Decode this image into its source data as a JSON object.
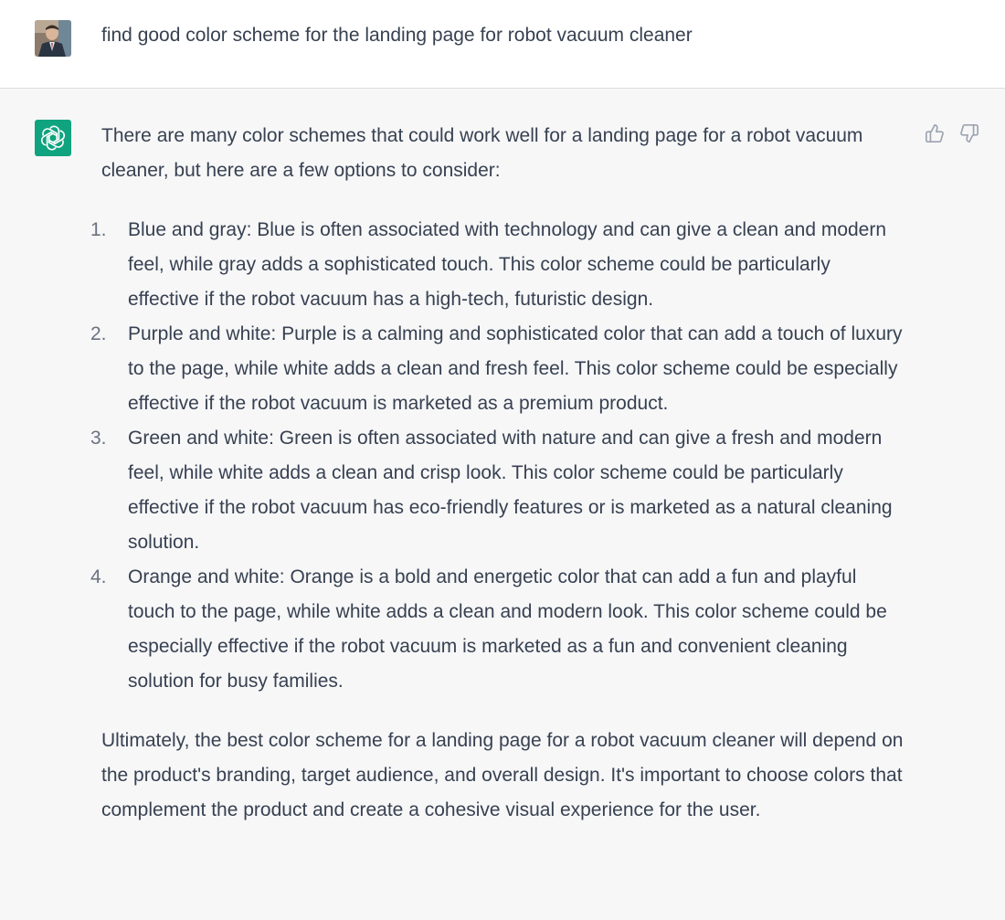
{
  "user_message": {
    "text": "find good color scheme for the landing page for robot vacuum cleaner"
  },
  "assistant_message": {
    "intro": "There are many color schemes that could work well for a landing page for a robot vacuum cleaner, but here are a few options to consider:",
    "items": [
      {
        "number": "1.",
        "text": "Blue and gray: Blue is often associated with technology and can give a clean and modern feel, while gray adds a sophisticated touch. This color scheme could be particularly effective if the robot vacuum has a high-tech, futuristic design."
      },
      {
        "number": "2.",
        "text": "Purple and white: Purple is a calming and sophisticated color that can add a touch of luxury to the page, while white adds a clean and fresh feel. This color scheme could be especially effective if the robot vacuum is marketed as a premium product."
      },
      {
        "number": "3.",
        "text": "Green and white: Green is often associated with nature and can give a fresh and modern feel, while white adds a clean and crisp look. This color scheme could be particularly effective if the robot vacuum has eco-friendly features or is marketed as a natural cleaning solution."
      },
      {
        "number": "4.",
        "text": "Orange and white: Orange is a bold and energetic color that can add a fun and playful touch to the page, while white adds a clean and modern look. This color scheme could be especially effective if the robot vacuum is marketed as a fun and convenient cleaning solution for busy families."
      }
    ],
    "conclusion": "Ultimately, the best color scheme for a landing page for a robot vacuum cleaner will depend on the product's branding, target audience, and overall design. It's important to choose colors that complement the product and create a cohesive visual experience for the user."
  },
  "icons": {
    "assistant_avatar": "openai-logo-icon",
    "thumbs_up": "thumbs-up-icon",
    "thumbs_down": "thumbs-down-icon"
  },
  "colors": {
    "assistant_avatar_bg": "#10a37f",
    "assistant_row_bg": "#f7f7f8",
    "user_row_bg": "#ffffff",
    "text": "#374151"
  }
}
